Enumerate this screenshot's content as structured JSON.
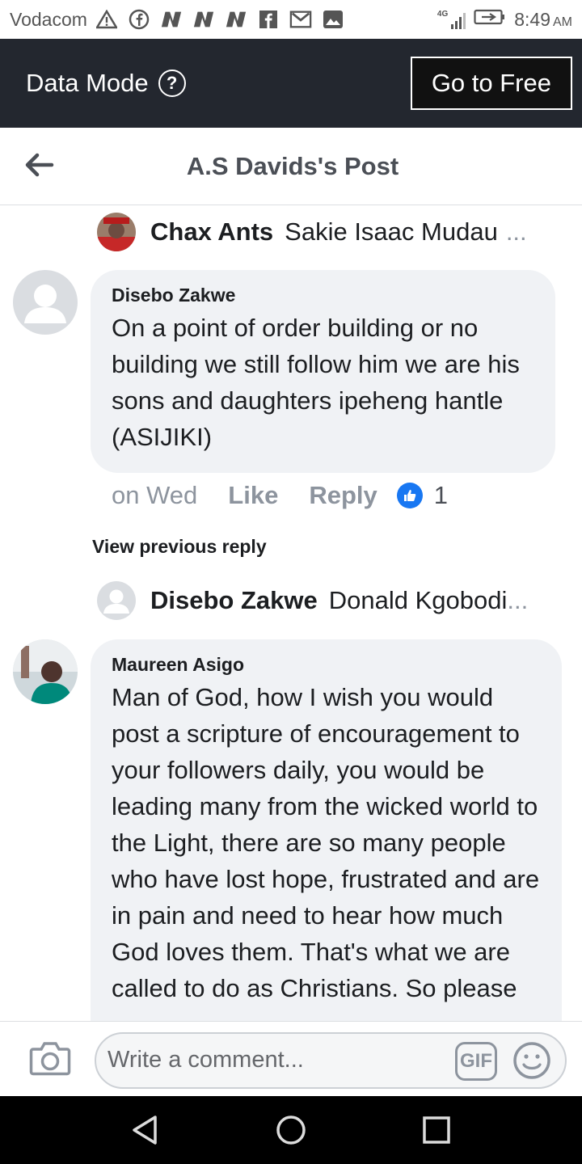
{
  "status_bar": {
    "carrier": "Vodacom",
    "network": "4G",
    "time": "8:49",
    "time_suffix": "AM",
    "icons": [
      "warning-icon",
      "facebook-icon",
      "n-icon",
      "n-icon",
      "n-icon",
      "facebook-lite-icon",
      "gmail-icon",
      "image-icon",
      "signal-icon",
      "battery-icon"
    ]
  },
  "data_mode": {
    "label": "Data Mode",
    "help_symbol": "?",
    "go_free_label": "Go to Free"
  },
  "header": {
    "title": "A.S Davids's Post"
  },
  "comments": [
    {
      "preview": {
        "name": "Chax Ants",
        "text": "Sakie Isaac Mudau",
        "ellipsis": "..."
      },
      "author": "Disebo Zakwe",
      "text": "On a point  of order building  or no building  we still follow  him we are his sons and daughters  ipeheng  hantle  (ASIJIKI)",
      "time": "on Wed",
      "like_label": "Like",
      "reply_label": "Reply",
      "likes": "1"
    },
    {
      "view_previous": "View previous reply",
      "preview": {
        "name": "Disebo Zakwe",
        "text": "Donald Kgobodi",
        "ellipsis": "..."
      },
      "author": "Maureen Asigo",
      "text": "Man of God, how I wish you would post a scripture of encouragement to your  followers daily, you would be leading  many from the wicked world  to the Light, there are so many people who have lost hope, frustrated and are  in  pain  and need to hear how much God loves them. That's  what we are called to do as Christians. So please"
    }
  ],
  "composer": {
    "placeholder": "Write a comment...",
    "gif_label": "GIF"
  },
  "colors": {
    "data_mode_bg": "#23272f",
    "bubble_bg": "#f0f2f5",
    "like_blue": "#1877f2",
    "muted_text": "#8d949e"
  }
}
